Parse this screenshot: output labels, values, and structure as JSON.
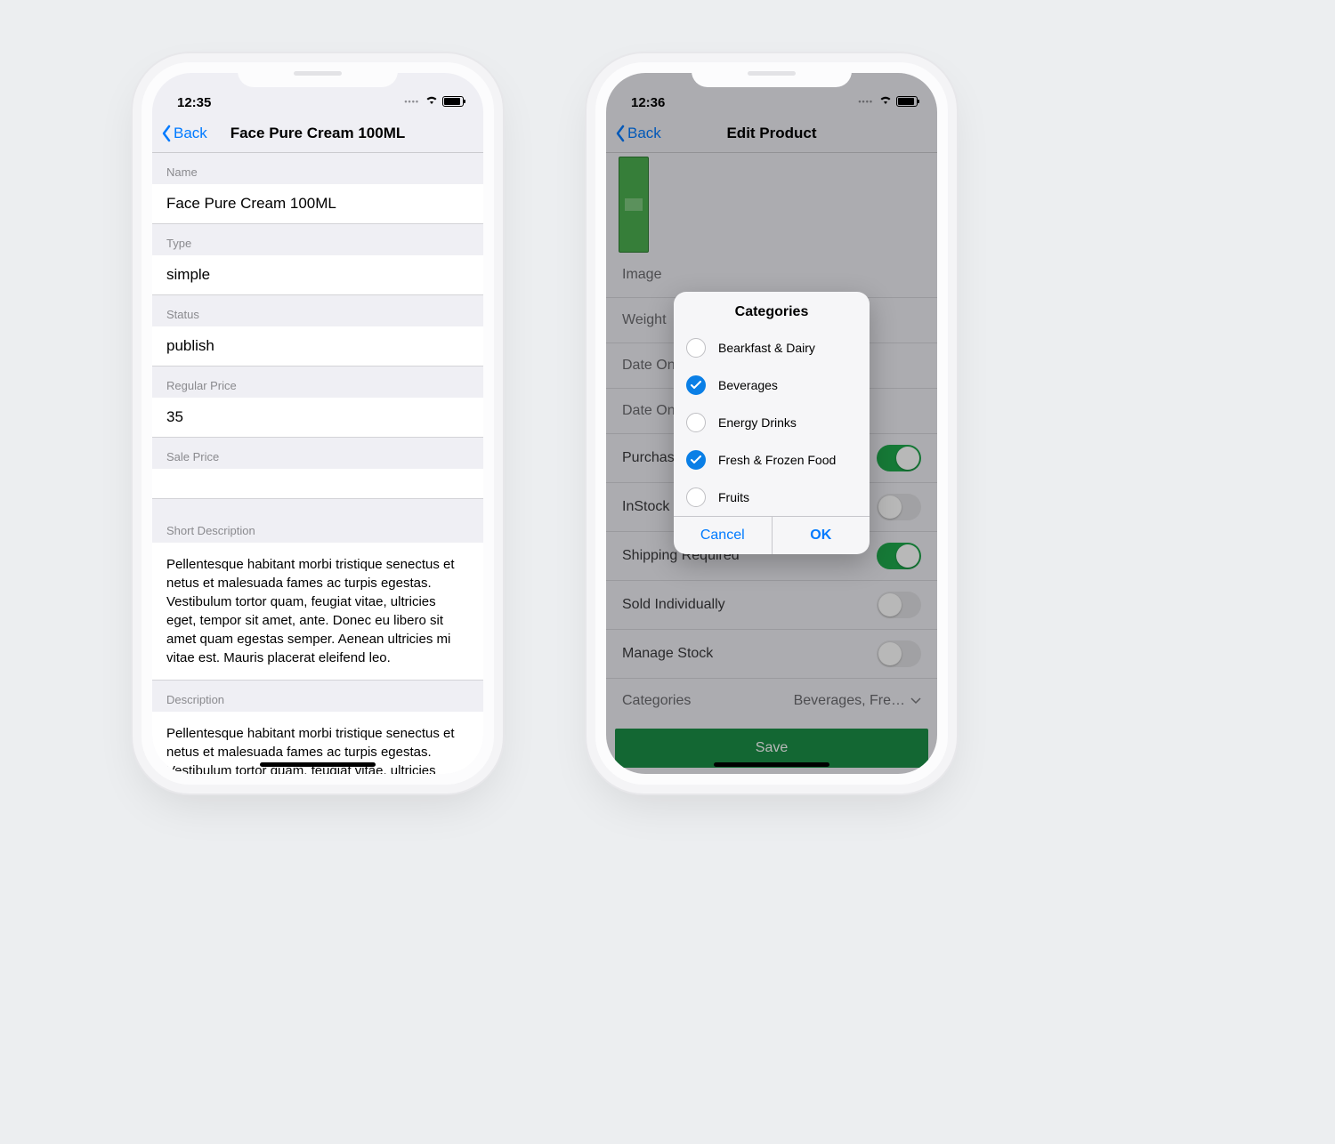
{
  "left": {
    "time": "12:35",
    "back_label": "Back",
    "title": "Face Pure Cream 100ML",
    "labels": {
      "name": "Name",
      "type": "Type",
      "status": "Status",
      "regular_price": "Regular Price",
      "sale_price": "Sale Price",
      "short_desc": "Short Description",
      "desc": "Description"
    },
    "values": {
      "name": "Face Pure Cream 100ML",
      "type": "simple",
      "status": "publish",
      "regular_price": "35",
      "sale_price": ""
    },
    "short_desc": "Pellentesque habitant morbi tristique senectus et netus et malesuada fames ac turpis egestas. Vestibulum tortor quam, feugiat vitae, ultricies eget, tempor sit amet, ante. Donec eu libero sit amet quam egestas semper. Aenean ultricies mi vitae est. Mauris placerat eleifend leo.",
    "desc": "Pellentesque habitant morbi tristique senectus et netus et malesuada fames ac turpis egestas. Vestibulum tortor quam, feugiat vitae, ultricies eget, tempor sit amet, ante. Donec eu libero sit amet quam egestas semper. Aenean ultricies mi vitae est. Mauris placerat eleifend leo."
  },
  "right": {
    "time": "12:36",
    "back_label": "Back",
    "title": "Edit Product",
    "rows": {
      "image": "Image",
      "weight": "Weight",
      "date_on_s1": "Date On S",
      "date_on_s2": "Date On S",
      "purchas": "Purchas",
      "instock": "InStock",
      "shipping": "Shipping Required",
      "sold": "Sold Individually",
      "manage": "Manage Stock",
      "categories": "Categories"
    },
    "toggles": {
      "purchas": true,
      "instock": false,
      "shipping": true,
      "sold": false,
      "manage": false
    },
    "categories_value": "Beverages, Fre…",
    "save_label": "Save",
    "modal": {
      "title": "Categories",
      "options": [
        {
          "label": "Bearkfast & Dairy",
          "checked": false
        },
        {
          "label": "Beverages",
          "checked": true
        },
        {
          "label": "Energy Drinks",
          "checked": false
        },
        {
          "label": "Fresh & Frozen Food",
          "checked": true
        },
        {
          "label": "Fruits",
          "checked": false
        }
      ],
      "cancel": "Cancel",
      "ok": "OK"
    }
  }
}
